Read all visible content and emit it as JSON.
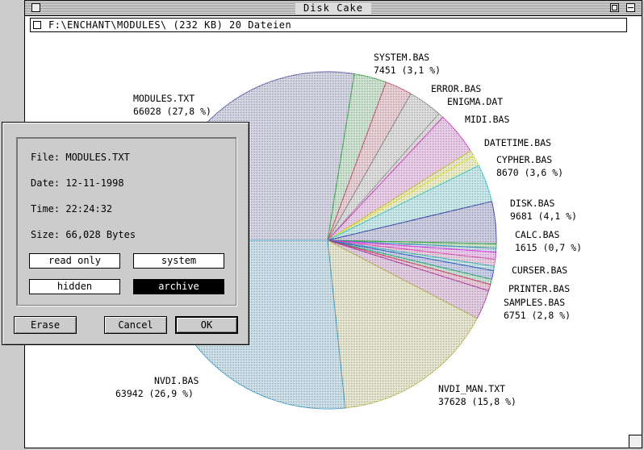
{
  "window": {
    "title": "Disk Cake",
    "path": "F:\\ENCHANT\\MODULES\\ (232 KB) 20 Dateien"
  },
  "chart_data": {
    "type": "pie",
    "total_bytes": 237500,
    "slices": [
      {
        "name": "MODULES.TXT",
        "bytes": 66028,
        "label": "66028 (27,8 %)",
        "color": "#5a5aa8"
      },
      {
        "name": "SYSTEM.BAS",
        "bytes": 7451,
        "label": "7451 (3,1 %)",
        "color": "#33aa44"
      },
      {
        "name": "ERROR.BAS",
        "bytes": 6200,
        "label": "",
        "color": "#cc4466"
      },
      {
        "name": "ENIGMA.DAT",
        "bytes": 7800,
        "label": "",
        "color": "#888888"
      },
      {
        "name": "",
        "bytes": 1200,
        "label": "",
        "color": "#999999"
      },
      {
        "name": "MIDI.BAS",
        "bytes": 9900,
        "label": "",
        "color": "#dd33cc"
      },
      {
        "name": "",
        "bytes": 1300,
        "label": "",
        "color": "#cccc33"
      },
      {
        "name": "DATETIME.BAS",
        "bytes": 2500,
        "label": "",
        "color": "#eeee22"
      },
      {
        "name": "CYPHER.BAS",
        "bytes": 8670,
        "label": "8670 (3,6 %)",
        "color": "#22ccdd"
      },
      {
        "name": "DISK.BAS",
        "bytes": 9681,
        "label": "9681 (4,1 %)",
        "color": "#3333aa"
      },
      {
        "name": "",
        "bytes": 1000,
        "label": "",
        "color": "#22aa22"
      },
      {
        "name": "",
        "bytes": 900,
        "label": "",
        "color": "#3388cc"
      },
      {
        "name": "CALC.BAS",
        "bytes": 1615,
        "label": "1615 (0,7 %)",
        "color": "#ee22ee"
      },
      {
        "name": "",
        "bytes": 1600,
        "label": "",
        "color": "#dd44aa"
      },
      {
        "name": "",
        "bytes": 1000,
        "label": "",
        "color": "#22bbbb"
      },
      {
        "name": "CURSER.BAS",
        "bytes": 2000,
        "label": "",
        "color": "#2244cc"
      },
      {
        "name": "",
        "bytes": 1200,
        "label": "",
        "color": "#22aa66"
      },
      {
        "name": "PRINTER.BAS",
        "bytes": 1500,
        "label": "",
        "color": "#dd2266"
      },
      {
        "name": "SAMPLES.BAS",
        "bytes": 6751,
        "label": "6751 (2,8 %)",
        "color": "#aa33aa"
      },
      {
        "name": "NVDI_MAN.TXT",
        "bytes": 37628,
        "label": "37628 (15,8 %)",
        "color": "#bbbb44"
      },
      {
        "name": "NVDI.BAS",
        "bytes": 63942,
        "label": "63942 (26,9 %)",
        "color": "#3399cc"
      }
    ]
  },
  "dialog": {
    "file": "File: MODULES.TXT",
    "date": "Date: 12-11-1998",
    "time": "Time: 22:24:32",
    "size": "Size: 66,028 Bytes",
    "attributes": {
      "read_only": "read only",
      "system": "system",
      "hidden": "hidden",
      "archive": "archive",
      "archive_selected": true
    },
    "buttons": {
      "erase": "Erase",
      "cancel": "Cancel",
      "ok": "OK"
    }
  }
}
